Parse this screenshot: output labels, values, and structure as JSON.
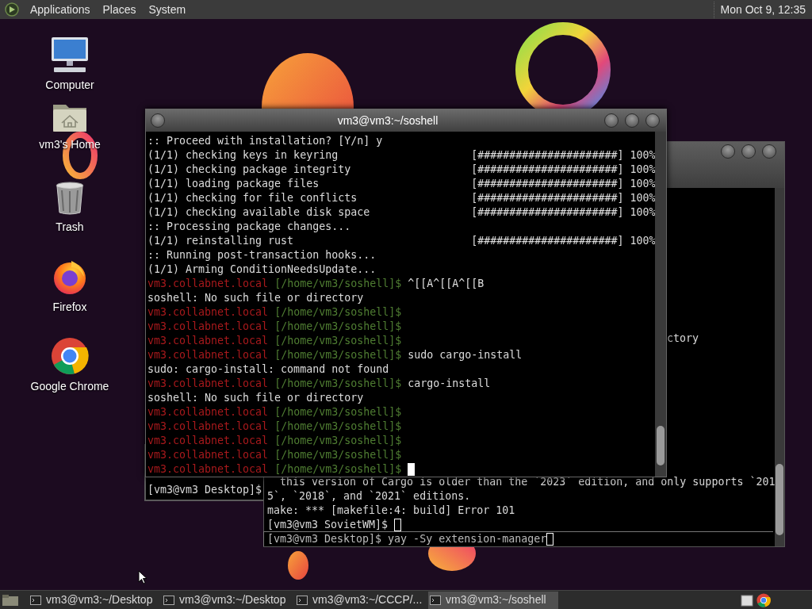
{
  "top_panel": {
    "menus": [
      "Applications",
      "Places",
      "System"
    ],
    "clock": "Mon Oct 9, 12:35"
  },
  "desktop_icons": [
    {
      "kind": "computer",
      "label": "Computer"
    },
    {
      "kind": "home",
      "label": "vm3's Home"
    },
    {
      "kind": "trash",
      "label": "Trash"
    },
    {
      "kind": "firefox",
      "label": "Firefox"
    },
    {
      "kind": "chrome",
      "label": "Google Chrome"
    }
  ],
  "back_left_window": {
    "lines": [
      "[vm3@vm3 Desktop]$"
    ]
  },
  "back_right_window": {
    "cut_line": "ctory",
    "lines": [
      "  this version of Cargo is older than the `2023` edition, and only supports `201",
      "5`, `2018`, and `2021` editions.",
      "make: *** [makefile:4: build] Error 101"
    ],
    "prompt": "[vm3@vm3 SovietWM]$",
    "cursor": true
  },
  "desktop_terminal": {
    "line": "[vm3@vm3 Desktop]$ yay -Sy extension-manager",
    "cursor": true
  },
  "front_window": {
    "title": "vm3@vm3:~/soshell",
    "lines": [
      {
        "kind": "text",
        "text": ":: Proceed with installation? [Y/n] y"
      },
      {
        "kind": "progress",
        "text": "(1/1) checking keys in keyring",
        "bar": "[######################]",
        "percent": "100%"
      },
      {
        "kind": "progress",
        "text": "(1/1) checking package integrity",
        "bar": "[######################]",
        "percent": "100%"
      },
      {
        "kind": "progress",
        "text": "(1/1) loading package files",
        "bar": "[######################]",
        "percent": "100%"
      },
      {
        "kind": "progress",
        "text": "(1/1) checking for file conflicts",
        "bar": "[######################]",
        "percent": "100%"
      },
      {
        "kind": "progress",
        "text": "(1/1) checking available disk space",
        "bar": "[######################]",
        "percent": "100%"
      },
      {
        "kind": "text",
        "text": ":: Processing package changes..."
      },
      {
        "kind": "progress",
        "text": "(1/1) reinstalling rust",
        "bar": "[######################]",
        "percent": "100%"
      },
      {
        "kind": "text",
        "text": ":: Running post-transaction hooks..."
      },
      {
        "kind": "text",
        "text": "(1/1) Arming ConditionNeedsUpdate..."
      },
      {
        "kind": "prompt",
        "host": "vm3.collabnet.local",
        "path": "[/home/vm3/soshell]$",
        "command": "^[[A^[[A^[[B"
      },
      {
        "kind": "text",
        "text": "soshell: No such file or directory"
      },
      {
        "kind": "prompt",
        "host": "vm3.collabnet.local",
        "path": "[/home/vm3/soshell]$"
      },
      {
        "kind": "prompt",
        "host": "vm3.collabnet.local",
        "path": "[/home/vm3/soshell]$"
      },
      {
        "kind": "prompt",
        "host": "vm3.collabnet.local",
        "path": "[/home/vm3/soshell]$"
      },
      {
        "kind": "prompt",
        "host": "vm3.collabnet.local",
        "path": "[/home/vm3/soshell]$",
        "command": "sudo cargo-install"
      },
      {
        "kind": "text",
        "text": "sudo: cargo-install: command not found"
      },
      {
        "kind": "prompt",
        "host": "vm3.collabnet.local",
        "path": "[/home/vm3/soshell]$",
        "command": "cargo-install"
      },
      {
        "kind": "text",
        "text": "soshell: No such file or directory"
      },
      {
        "kind": "prompt",
        "host": "vm3.collabnet.local",
        "path": "[/home/vm3/soshell]$"
      },
      {
        "kind": "prompt",
        "host": "vm3.collabnet.local",
        "path": "[/home/vm3/soshell]$"
      },
      {
        "kind": "prompt",
        "host": "vm3.collabnet.local",
        "path": "[/home/vm3/soshell]$"
      },
      {
        "kind": "prompt",
        "host": "vm3.collabnet.local",
        "path": "[/home/vm3/soshell]$"
      },
      {
        "kind": "prompt",
        "host": "vm3.collabnet.local",
        "path": "[/home/vm3/soshell]$",
        "cursor": true
      }
    ]
  },
  "taskbar": {
    "items": [
      {
        "label": "vm3@vm3:~/Desktop",
        "selected": false
      },
      {
        "label": "vm3@vm3:~/Desktop",
        "selected": false
      },
      {
        "label": "vm3@vm3:~/CCCP/...",
        "selected": false
      },
      {
        "label": "vm3@vm3:~/soshell",
        "selected": true
      }
    ]
  }
}
